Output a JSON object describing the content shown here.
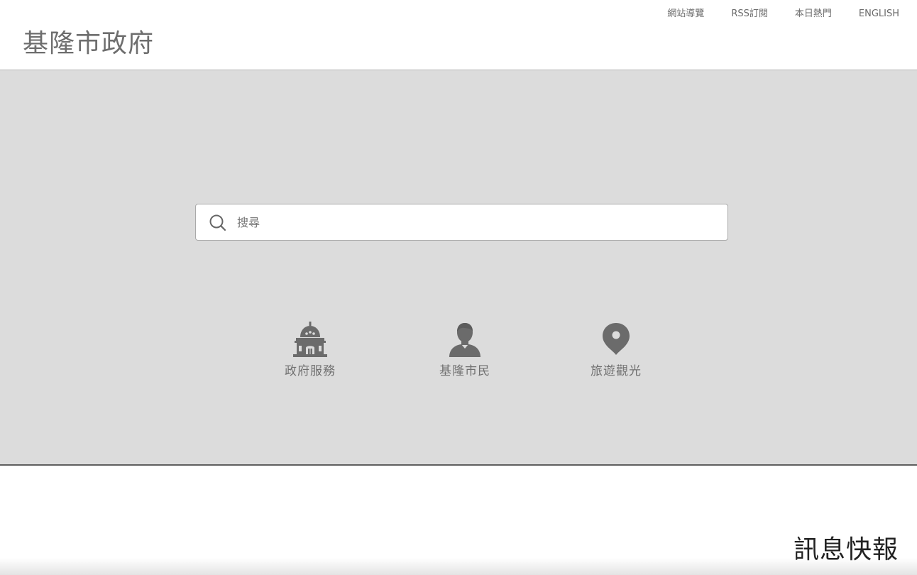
{
  "header": {
    "site_title": "基隆市政府",
    "top_links": [
      {
        "label": "網站導覽"
      },
      {
        "label": "RSS訂閱"
      },
      {
        "label": "本日熱門"
      },
      {
        "label": "ENGLISH"
      }
    ]
  },
  "hero": {
    "search": {
      "placeholder": "搜尋",
      "value": "",
      "icon": "search-icon"
    },
    "quick_links": [
      {
        "label": "政府服務",
        "icon": "government-building-icon"
      },
      {
        "label": "基隆市民",
        "icon": "citizen-person-icon"
      },
      {
        "label": "旅遊觀光",
        "icon": "map-pin-icon"
      }
    ]
  },
  "news": {
    "section_title": "訊息快報"
  },
  "colors": {
    "hero_background": "#dcdcdc",
    "icon_color": "#6b6b6b",
    "text_gray": "#6e6e6e"
  }
}
